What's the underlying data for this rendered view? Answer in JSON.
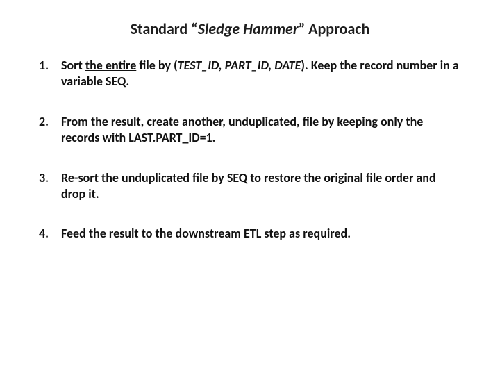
{
  "title": {
    "pre": "Standard ",
    "q_open": "“",
    "mid": "Sledge Hammer",
    "q_close": "”",
    "post": " Approach"
  },
  "steps": [
    {
      "num": "1.",
      "t1": "Sort ",
      "u1": "the entire",
      "t2": " file by (",
      "i1": "TEST_ID, PART_ID, DATE",
      "t3": "). Keep the record number in a variable SEQ."
    },
    {
      "num": "2.",
      "t1": "From the result, create another, unduplicated, file by keeping only the records with LAST.PART_ID=1."
    },
    {
      "num": "3.",
      "t1": "Re-sort the unduplicated file by SEQ to restore the original file order and drop it."
    },
    {
      "num": "4.",
      "t1": "Feed the result to the downstream ETL step as required."
    }
  ]
}
